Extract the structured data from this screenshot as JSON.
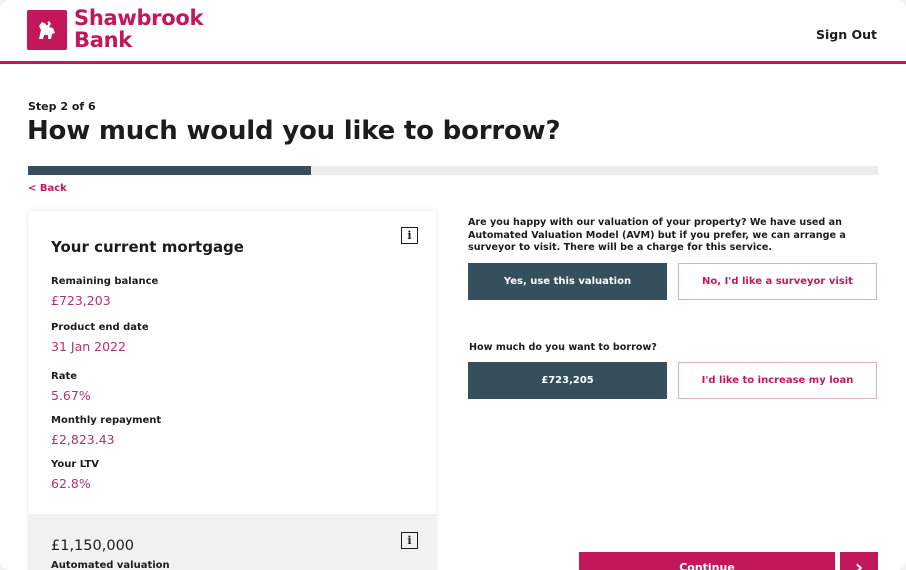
{
  "brand": {
    "name_line1": "Shawbrook",
    "name_line2": "Bank",
    "color": "#c2185b"
  },
  "header": {
    "sign_out": "Sign Out"
  },
  "page": {
    "step": "Step 2 of 6",
    "title": "How much would you like to borrow?",
    "progress_fraction": 0.333,
    "back": "< Back"
  },
  "mortgage_card": {
    "title": "Your current mortgage",
    "info_icon": "i",
    "fields": [
      {
        "label": "Remaining balance",
        "value": "£723,203"
      },
      {
        "label": "Product end date",
        "value": "31 Jan 2022"
      },
      {
        "label": "Rate",
        "value": "5.67%"
      },
      {
        "label": "Monthly repayment",
        "value": "£2,823.43"
      },
      {
        "label": "Your LTV",
        "value": "62.8%"
      }
    ],
    "valuation": {
      "amount": "£1,150,000",
      "label": "Automated valuation",
      "info_icon": "i"
    }
  },
  "valuation_question": {
    "text": "Are you happy with our valuation of your property? We have used an Automated Valuation Model (AVM) but if you prefer, we can arrange a surveyor to visit. There will be a charge for this service.",
    "yes_button": "Yes, use this valuation",
    "no_button": "No, I'd like a surveyor visit"
  },
  "borrow_question": {
    "text": "How much do you want to borrow?",
    "amount_button": "£723,205",
    "increase_button": "I'd like to increase my loan"
  },
  "footer": {
    "continue": "Continue",
    "next_icon": "›"
  },
  "colors": {
    "primary_dark": "#35505c",
    "accent": "#c2185b",
    "value_text": "#b5316d"
  }
}
